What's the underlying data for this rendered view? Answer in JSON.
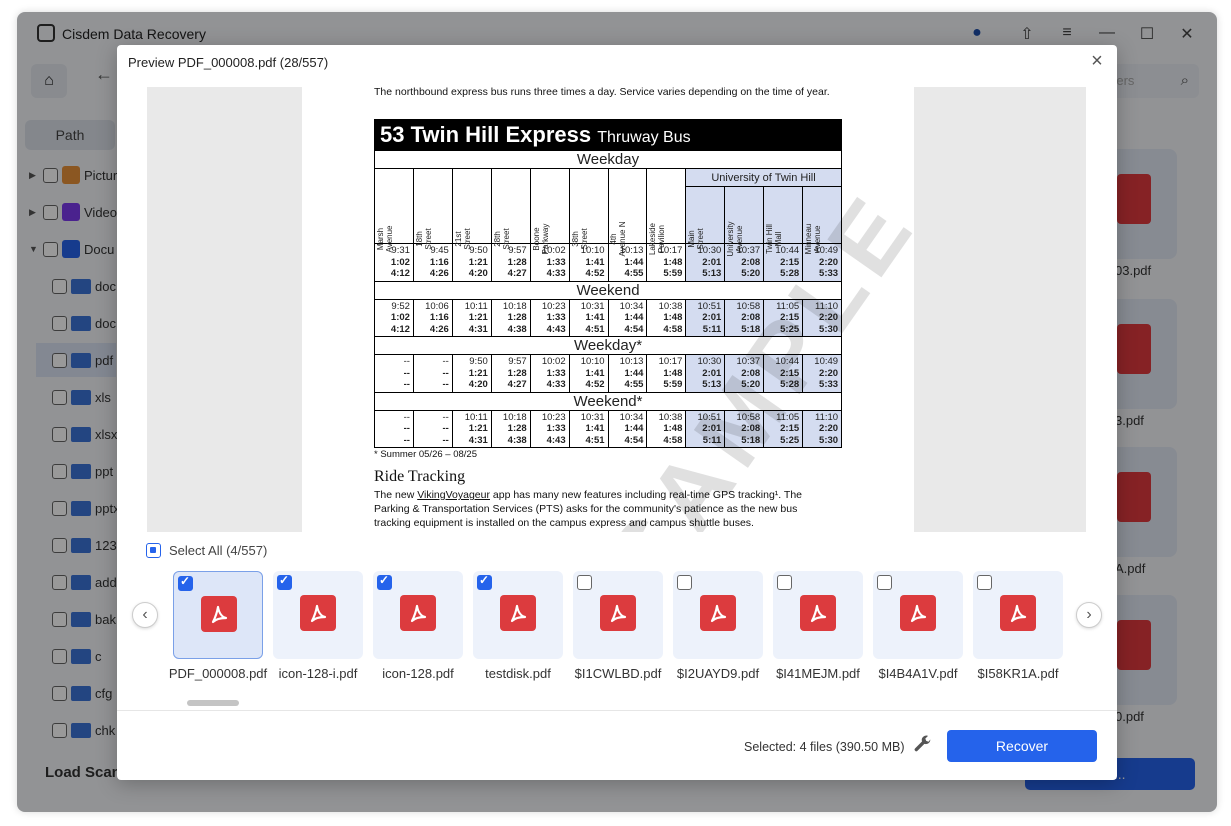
{
  "app": {
    "title": "Cisdem Data Recovery",
    "search_placeholder": "olders",
    "path_tab": "Path",
    "tree": [
      {
        "label": "Pictur",
        "type": "pictures",
        "expanded": false
      },
      {
        "label": "Video",
        "type": "videos",
        "expanded": false
      },
      {
        "label": "Docu",
        "type": "documents",
        "expanded": true
      }
    ],
    "folders": [
      "doc",
      "doc",
      "pdf",
      "xls",
      "xlsx",
      "ppt",
      "pptx",
      "123",
      "add",
      "bak",
      "c",
      "cfg",
      "chk"
    ],
    "right_labels": [
      "03.pdf",
      "3.pdf",
      "A.pdf",
      "0.pdf"
    ],
    "footer": {
      "load_scan": "Load Scan",
      "recover_all": "All ..."
    }
  },
  "modal": {
    "title": "Preview PDF_000008.pdf (28/557)",
    "close": "×",
    "select_all": "Select All (4/557)",
    "selected_info": "Selected: 4 files (390.50 MB)",
    "recover": "Recover",
    "prev": "‹",
    "next": "›"
  },
  "document": {
    "intro": "The northbound express bus runs three times a day. Service varies depending on the time of year.",
    "route_title": "53 Twin Hill Express",
    "route_sub": "Thruway Bus",
    "university_label": "University of Twin Hill",
    "stops": [
      [
        "Marsh",
        "Avenue"
      ],
      [
        "18th",
        "Street"
      ],
      [
        "21st",
        "Street"
      ],
      [
        "28th",
        "Street"
      ],
      [
        "Boone",
        "Parkway"
      ],
      [
        "38th",
        "Street"
      ],
      [
        "4th",
        "Avenue N"
      ],
      [
        "Lakeside",
        "Pavilion"
      ],
      [
        "Main",
        "Street"
      ],
      [
        "University",
        "Avenue"
      ],
      [
        "Twin Hill",
        "Mall"
      ],
      [
        "Minneau",
        "Avenue"
      ]
    ],
    "sections": [
      {
        "title": "Weekday",
        "rows": [
          [
            "9:31",
            "9:45",
            "9:50",
            "9:57",
            "10:02",
            "10:10",
            "10:13",
            "10:17",
            "10:30",
            "10:37",
            "10:44",
            "10:49"
          ],
          [
            "1:02",
            "1:16",
            "1:21",
            "1:28",
            "1:33",
            "1:41",
            "1:44",
            "1:48",
            "2:01",
            "2:08",
            "2:15",
            "2:20"
          ],
          [
            "4:12",
            "4:26",
            "4:20",
            "4:27",
            "4:33",
            "4:52",
            "4:55",
            "5:59",
            "5:13",
            "5:20",
            "5:28",
            "5:33"
          ]
        ]
      },
      {
        "title": "Weekend",
        "rows": [
          [
            "9:52",
            "10:06",
            "10:11",
            "10:18",
            "10:23",
            "10:31",
            "10:34",
            "10:38",
            "10:51",
            "10:58",
            "11:05",
            "11:10"
          ],
          [
            "1:02",
            "1:16",
            "1:21",
            "1:28",
            "1:33",
            "1:41",
            "1:44",
            "1:48",
            "2:01",
            "2:08",
            "2:15",
            "2:20"
          ],
          [
            "4:12",
            "4:26",
            "4:31",
            "4:38",
            "4:43",
            "4:51",
            "4:54",
            "4:58",
            "5:11",
            "5:18",
            "5:25",
            "5:30"
          ]
        ]
      },
      {
        "title": "Weekday*",
        "rows": [
          [
            "--",
            "--",
            "9:50",
            "9:57",
            "10:02",
            "10:10",
            "10:13",
            "10:17",
            "10:30",
            "10:37",
            "10:44",
            "10:49"
          ],
          [
            "--",
            "--",
            "1:21",
            "1:28",
            "1:33",
            "1:41",
            "1:44",
            "1:48",
            "2:01",
            "2:08",
            "2:15",
            "2:20"
          ],
          [
            "--",
            "--",
            "4:20",
            "4:27",
            "4:33",
            "4:52",
            "4:55",
            "5:59",
            "5:13",
            "5:20",
            "5:28",
            "5:33"
          ]
        ]
      },
      {
        "title": "Weekend*",
        "rows": [
          [
            "--",
            "--",
            "10:11",
            "10:18",
            "10:23",
            "10:31",
            "10:34",
            "10:38",
            "10:51",
            "10:58",
            "11:05",
            "11:10"
          ],
          [
            "--",
            "--",
            "1:21",
            "1:28",
            "1:33",
            "1:41",
            "1:44",
            "1:48",
            "2:01",
            "2:08",
            "2:15",
            "2:20"
          ],
          [
            "--",
            "--",
            "4:31",
            "4:38",
            "4:43",
            "4:51",
            "4:54",
            "4:58",
            "5:11",
            "5:18",
            "5:25",
            "5:30"
          ]
        ]
      }
    ],
    "footnote": "* Summer 05/26 – 08/25",
    "ride_title": "Ride Tracking",
    "ride_text_1": "The new ",
    "ride_link": "VikingVoyageur",
    "ride_text_2": " app has many new features including real-time GPS tracking¹. The Parking & Transportation Services (PTS) asks for the community's patience as the new bus tracking equipment is installed on the campus express and campus shuttle buses.",
    "watermark": "SAMPLE"
  },
  "thumbnails": [
    {
      "name": "PDF_000008.pdf",
      "checked": true,
      "active": true
    },
    {
      "name": "icon-128-i.pdf",
      "checked": true,
      "active": false
    },
    {
      "name": "icon-128.pdf",
      "checked": true,
      "active": false
    },
    {
      "name": "testdisk.pdf",
      "checked": true,
      "active": false
    },
    {
      "name": "$I1CWLBD.pdf",
      "checked": false,
      "active": false
    },
    {
      "name": "$I2UAYD9.pdf",
      "checked": false,
      "active": false
    },
    {
      "name": "$I41MEJM.pdf",
      "checked": false,
      "active": false
    },
    {
      "name": "$I4B4A1V.pdf",
      "checked": false,
      "active": false
    },
    {
      "name": "$I58KR1A.pdf",
      "checked": false,
      "active": false
    }
  ],
  "colors": {
    "accent": "#2563eb",
    "pdf_red": "#dc3b3e",
    "university_blue": "#d4dcf0"
  }
}
